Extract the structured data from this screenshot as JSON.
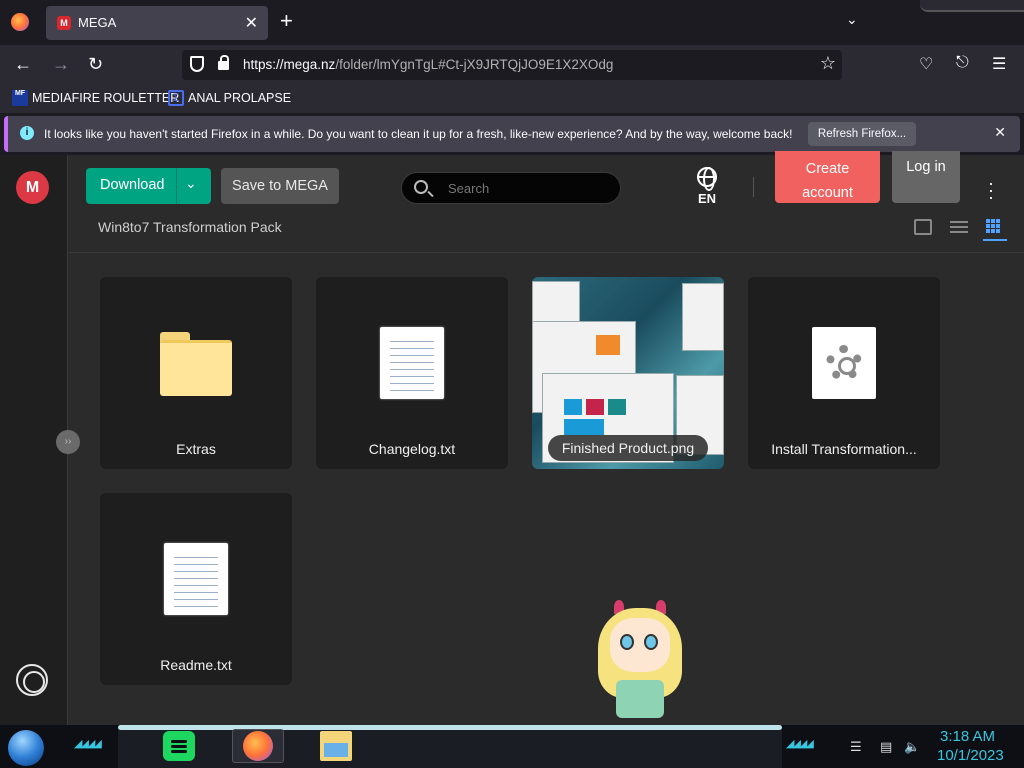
{
  "browser": {
    "tab": {
      "title": "MEGA",
      "favicon": "M"
    },
    "url": {
      "host": "https://mega.nz",
      "path": "/folder/lmYgnTgL#Ct-jX9JRTQjJO9E1X2XOdg"
    },
    "bookmarks": [
      {
        "label": "MEDIAFIRE ROULETTER",
        "icon": "MF"
      },
      {
        "label": "ANAL PROLAPSE",
        "icon": "sigma-icon"
      }
    ],
    "notification": {
      "message": "It looks like you haven't started Firefox in a while. Do you want to clean it up for a fresh, like-new experience? And by the way, welcome back!",
      "button": "Refresh Firefox..."
    }
  },
  "mega": {
    "logo": "M",
    "download_label": "Download",
    "save_label": "Save to MEGA",
    "search_placeholder": "Search",
    "language": "EN",
    "create_account_line1": "Create",
    "create_account_line2": "account",
    "login_label": "Log in",
    "breadcrumb": "Win8to7 Transformation Pack",
    "items": [
      {
        "name": "Extras",
        "type": "folder"
      },
      {
        "name": "Changelog.txt",
        "type": "text"
      },
      {
        "name": "Finished Product.png",
        "type": "image"
      },
      {
        "name": "Install Transformation...",
        "type": "executable"
      },
      {
        "name": "Readme.txt",
        "type": "text"
      }
    ],
    "colors": {
      "download": "#00a382",
      "create": "#f0615f",
      "logo": "#dd3944",
      "active_view": "#4da3ff"
    }
  },
  "taskbar": {
    "time": "3:18 AM",
    "date": "10/1/2023"
  }
}
